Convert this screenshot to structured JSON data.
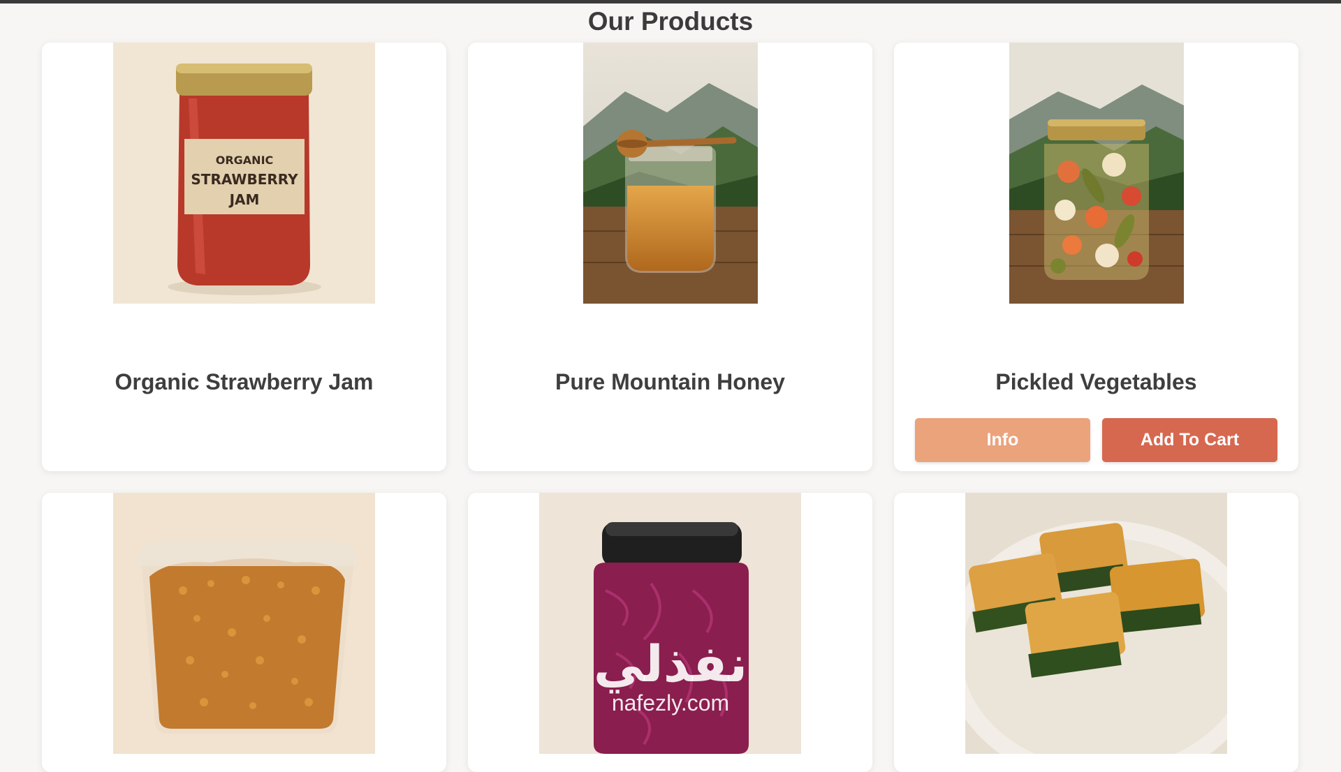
{
  "page": {
    "title": "Our Products"
  },
  "products": [
    {
      "name": "Organic Strawberry Jam",
      "image": "strawberry-jam-jar"
    },
    {
      "name": "Pure Mountain Honey",
      "image": "honey-jar-mountains"
    },
    {
      "name": "Pickled Vegetables",
      "image": "pickled-vegetables-jar",
      "info_label": "Info",
      "cart_label": "Add To Cart"
    },
    {
      "name": "",
      "image": "bulgur-plastic-container"
    },
    {
      "name": "",
      "image": "red-cabbage-pickle-jar"
    },
    {
      "name": "",
      "image": "spinach-pastry-plate"
    }
  ],
  "jam_label": [
    "ORGANIC",
    "STRAWBERRY",
    "JAM"
  ],
  "watermark": {
    "arabic": "نفذلي",
    "latin": "nafezly.com"
  },
  "colors": {
    "info_button": "#eba37c",
    "cart_button": "#d6684f",
    "title_text": "#3b3b3b"
  }
}
